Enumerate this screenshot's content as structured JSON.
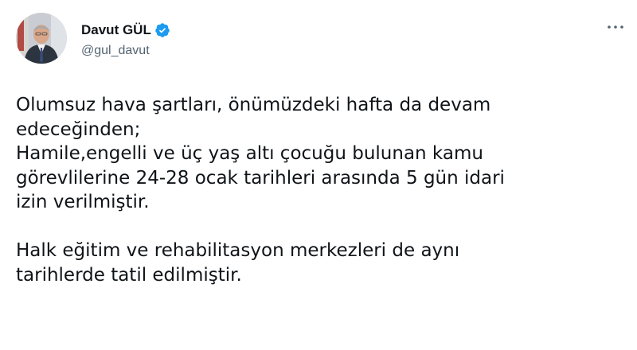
{
  "tweet": {
    "author": {
      "display_name": "Davut GÜL",
      "handle": "@gul_davut",
      "verified": true,
      "avatar": "profile-photo",
      "verified_color": "#1d9bf0"
    },
    "more_icon": "ellipsis-icon",
    "text_lines": [
      "Olumsuz hava şartları, önümüzdeki hafta da devam",
      "edeceğinden;",
      "Hamile,engelli ve üç yaş altı çocuğu bulunan kamu",
      "görevlilerine 24-28 ocak tarihleri arasında 5 gün idari",
      "izin verilmiştir.",
      "",
      "Halk eğitim ve rehabilitasyon merkezleri de aynı",
      "tarihlerde tatil edilmiştir."
    ]
  }
}
